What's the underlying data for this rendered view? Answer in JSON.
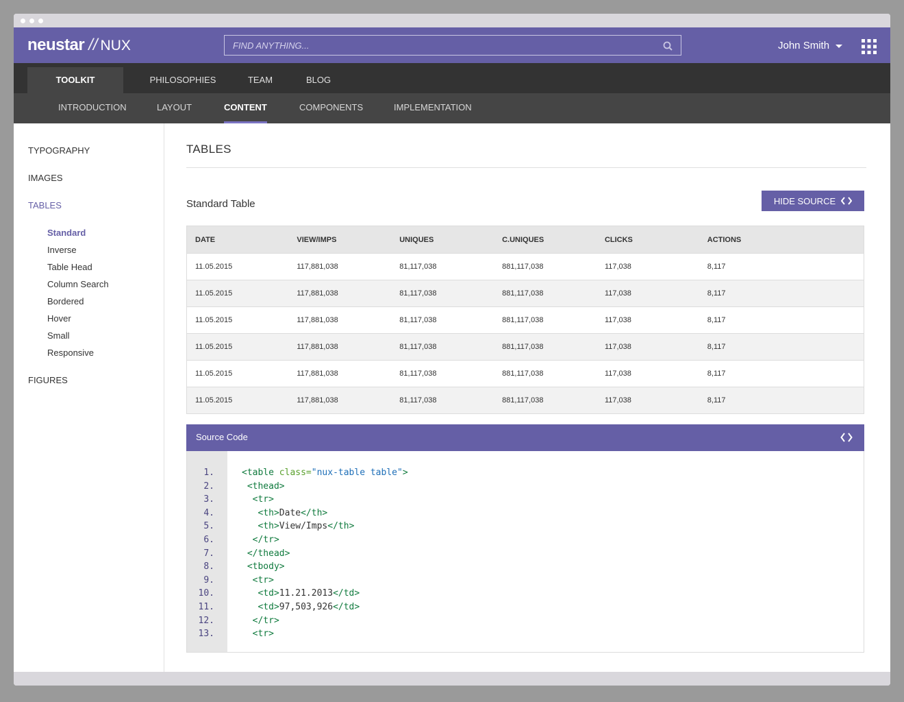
{
  "header": {
    "brand": "neustar",
    "slash": "//",
    "product": "NUX",
    "search_placeholder": "FIND ANYTHING...",
    "user_name": "John Smith"
  },
  "nav_primary": [
    "TOOLKIT",
    "PHILOSOPHIES",
    "TEAM",
    "BLOG"
  ],
  "nav_secondary": [
    "INTRODUCTION",
    "LAYOUT",
    "CONTENT",
    "COMPONENTS",
    "IMPLEMENTATION"
  ],
  "sidebar": {
    "items": [
      "TYPOGRAPHY",
      "IMAGES",
      "TABLES",
      "FIGURES"
    ],
    "sub_items": [
      "Standard",
      "Inverse",
      "Table Head",
      "Column Search",
      "Bordered",
      "Hover",
      "Small",
      "Responsive"
    ]
  },
  "main": {
    "page_title": "TABLES",
    "section_title": "Standard Table",
    "hide_source_label": "HIDE SOURCE"
  },
  "table": {
    "headers": [
      "DATE",
      "VIEW/IMPS",
      "UNIQUES",
      "C.UNIQUES",
      "CLICKS",
      "ACTIONS"
    ],
    "rows": [
      [
        "11.05.2015",
        "117,881,038",
        "81,117,038",
        "881,117,038",
        "117,038",
        "8,117"
      ],
      [
        "11.05.2015",
        "117,881,038",
        "81,117,038",
        "881,117,038",
        "117,038",
        "8,117"
      ],
      [
        "11.05.2015",
        "117,881,038",
        "81,117,038",
        "881,117,038",
        "117,038",
        "8,117"
      ],
      [
        "11.05.2015",
        "117,881,038",
        "81,117,038",
        "881,117,038",
        "117,038",
        "8,117"
      ],
      [
        "11.05.2015",
        "117,881,038",
        "81,117,038",
        "881,117,038",
        "117,038",
        "8,117"
      ],
      [
        "11.05.2015",
        "117,881,038",
        "81,117,038",
        "881,117,038",
        "117,038",
        "8,117"
      ]
    ]
  },
  "source": {
    "title": "Source Code",
    "line_numbers": [
      "1.",
      "2.",
      "3.",
      "4.",
      "5.",
      "6.",
      "7.",
      "8.",
      "9.",
      "10.",
      "11.",
      "12.",
      "13."
    ],
    "lines": [
      "<table class=\"nux-table table\">",
      " <thead>",
      "  <tr>",
      "   <th>Date</th>",
      "   <th>View/Imps</th>",
      "  </tr>",
      " </thead>",
      " <tbody>",
      "  <tr>",
      "   <td>11.21.2013</td>",
      "   <td>97,503,926</td>",
      "  </tr>",
      "  <tr>"
    ]
  },
  "colors": {
    "brand_purple": "#655fa6",
    "nav_dark": "#333333",
    "nav_mid": "#454545",
    "tag_green": "#0f7a3d",
    "attr_green": "#5aa02c",
    "value_blue": "#1e6fb8"
  },
  "icons": {
    "search": "search-icon",
    "user_menu": "caret-down-icon",
    "apps": "apps-grid-icon",
    "hide_source": "code-brackets-icon",
    "source_toggle": "code-brackets-icon"
  }
}
